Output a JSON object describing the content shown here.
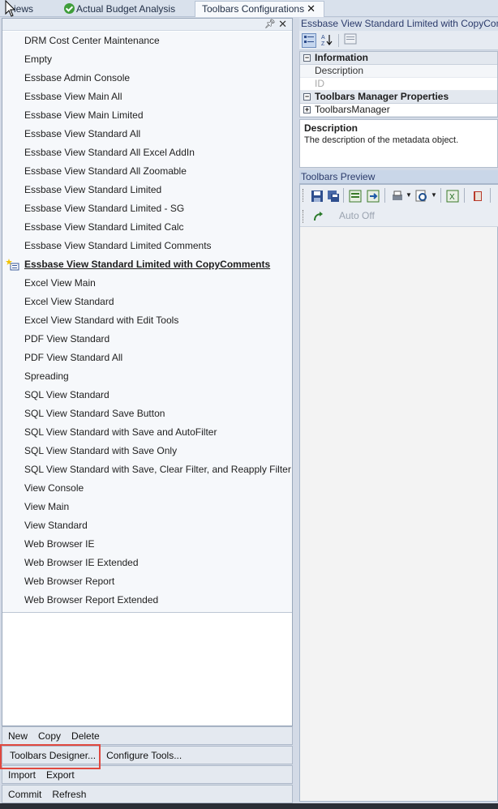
{
  "tabs": [
    {
      "label": "iews"
    },
    {
      "label": "Actual Budget Analysis"
    },
    {
      "label": "Toolbars Configurations",
      "close": "✕"
    }
  ],
  "panel": {
    "pin": "ᵖ",
    "close": "✕"
  },
  "toolbar_list": [
    "DRM Cost Center Maintenance",
    "Empty",
    "Essbase Admin Console",
    "Essbase View Main All",
    "Essbase View Main Limited",
    "Essbase View Standard All",
    "Essbase View Standard All Excel AddIn",
    "Essbase View Standard All Zoomable",
    "Essbase View Standard Limited",
    "Essbase View Standard Limited - SG",
    "Essbase View Standard Limited Calc",
    "Essbase View Standard Limited Comments",
    "Essbase View Standard Limited with CopyComments",
    "Excel View Main",
    "Excel View Standard",
    "Excel View Standard with Edit Tools",
    "PDF View Standard",
    "PDF View Standard All",
    "Spreading",
    "SQL View Standard",
    "SQL View Standard Save Button",
    "SQL View Standard with Save and AutoFilter",
    "SQL View Standard with Save Only",
    "SQL View Standard with Save, Clear Filter, and Reapply Filter",
    "View Console",
    "View Main",
    "View Standard",
    "Web Browser IE",
    "Web Browser IE Extended",
    "Web Browser Report",
    "Web Browser Report Extended"
  ],
  "selected_index": 12,
  "buttons": {
    "row1": [
      "New",
      "Copy",
      "Delete"
    ],
    "row2": [
      "Toolbars Designer...",
      "Configure Tools..."
    ],
    "row3": [
      "Import",
      "Export"
    ],
    "row4": [
      "Commit",
      "Refresh"
    ]
  },
  "right": {
    "title": "Essbase View Standard Limited with CopyComme",
    "categories": {
      "information": "Information",
      "description_prop": "Description",
      "id_prop": "ID",
      "manager_props": "Toolbars Manager Properties",
      "manager": "ToolbarsManager"
    },
    "description": {
      "title": "Description",
      "text": "The description of the metadata object."
    },
    "preview_title": "Toolbars Preview",
    "auto_off": "Auto Off"
  },
  "colors": {
    "highlight": "#e0483f",
    "accent": "#2a3a6a"
  }
}
